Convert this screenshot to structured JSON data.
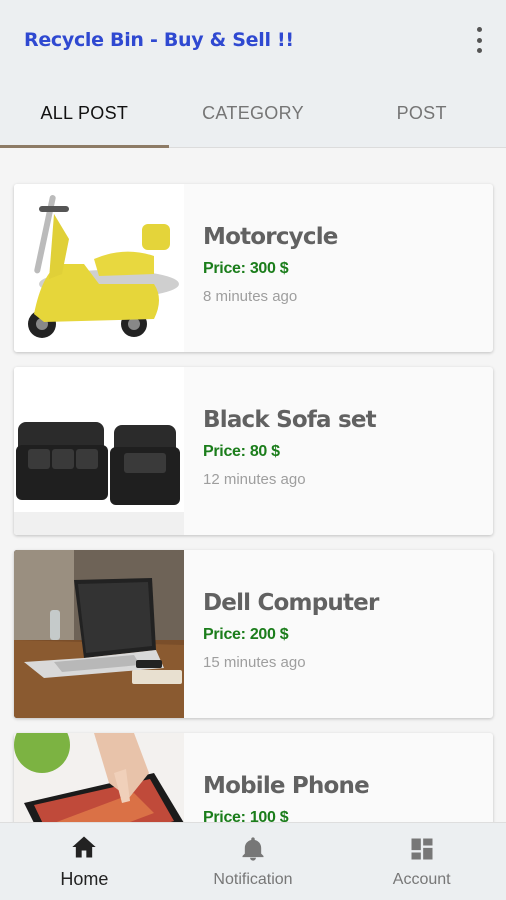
{
  "appbar": {
    "title": "Recycle Bin - Buy & Sell !!",
    "menu_icon": "more-vert-icon"
  },
  "tabs": [
    {
      "label": "ALL POST",
      "active": true
    },
    {
      "label": "CATEGORY",
      "active": false
    },
    {
      "label": "POST",
      "active": false
    }
  ],
  "posts": [
    {
      "title": "Motorcycle",
      "price": "Price: 300 $",
      "time": "8 minutes ago",
      "image": "yellow-scooter"
    },
    {
      "title": "Black Sofa set",
      "price": "Price: 80 $",
      "time": "12 minutes ago",
      "image": "black-sofa-set"
    },
    {
      "title": "Dell Computer",
      "price": "Price: 200 $",
      "time": "15 minutes ago",
      "image": "laptop-on-desk"
    },
    {
      "title": "Mobile Phone",
      "price": "Price: 100 $",
      "time": "",
      "image": "phone-in-hand"
    }
  ],
  "bottom_nav": [
    {
      "label": "Home",
      "icon": "home-icon",
      "active": true
    },
    {
      "label": "Notification",
      "icon": "bell-icon",
      "active": false
    },
    {
      "label": "Account",
      "icon": "dashboard-icon",
      "active": false
    }
  ],
  "colors": {
    "title": "#2f49d1",
    "price": "#1b7d1b",
    "appbar": "#eceff1"
  }
}
